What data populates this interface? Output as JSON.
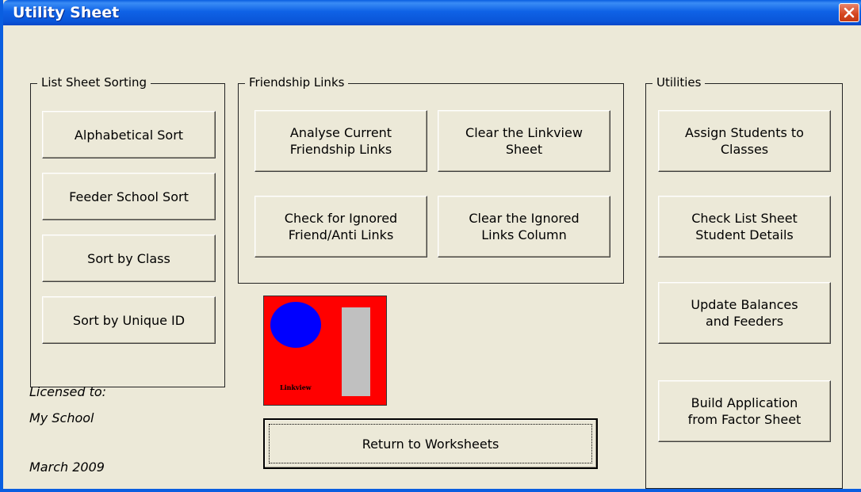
{
  "window": {
    "title": "Utility Sheet"
  },
  "groups": {
    "list_sorting": {
      "label": "List Sheet Sorting",
      "buttons": [
        "Alphabetical Sort",
        "Feeder School Sort",
        "Sort by Class",
        "Sort by Unique ID"
      ]
    },
    "friendship": {
      "label": "Friendship Links",
      "buttons": [
        "Analyse Current\nFriendship Links",
        "Clear the Linkview\nSheet",
        "Check for Ignored\nFriend/Anti Links",
        "Clear the Ignored\nLinks Column"
      ]
    },
    "utilities": {
      "label": "Utilities",
      "buttons": [
        "Assign Students to\nClasses",
        "Check List Sheet\nStudent Details",
        "Update Balances\nand Feeders",
        "Build Application\nfrom Factor Sheet"
      ]
    }
  },
  "return_button": "Return to Worksheets",
  "license": {
    "licensed_to_label": "Licensed to:",
    "school": "My School",
    "date": "March 2009"
  },
  "logo": {
    "text": "Linkview",
    "colors": {
      "background": "#ff0000",
      "circle": "#0000ff",
      "bar": "#c0c0c0"
    }
  },
  "icons": {
    "close": "close-icon"
  }
}
